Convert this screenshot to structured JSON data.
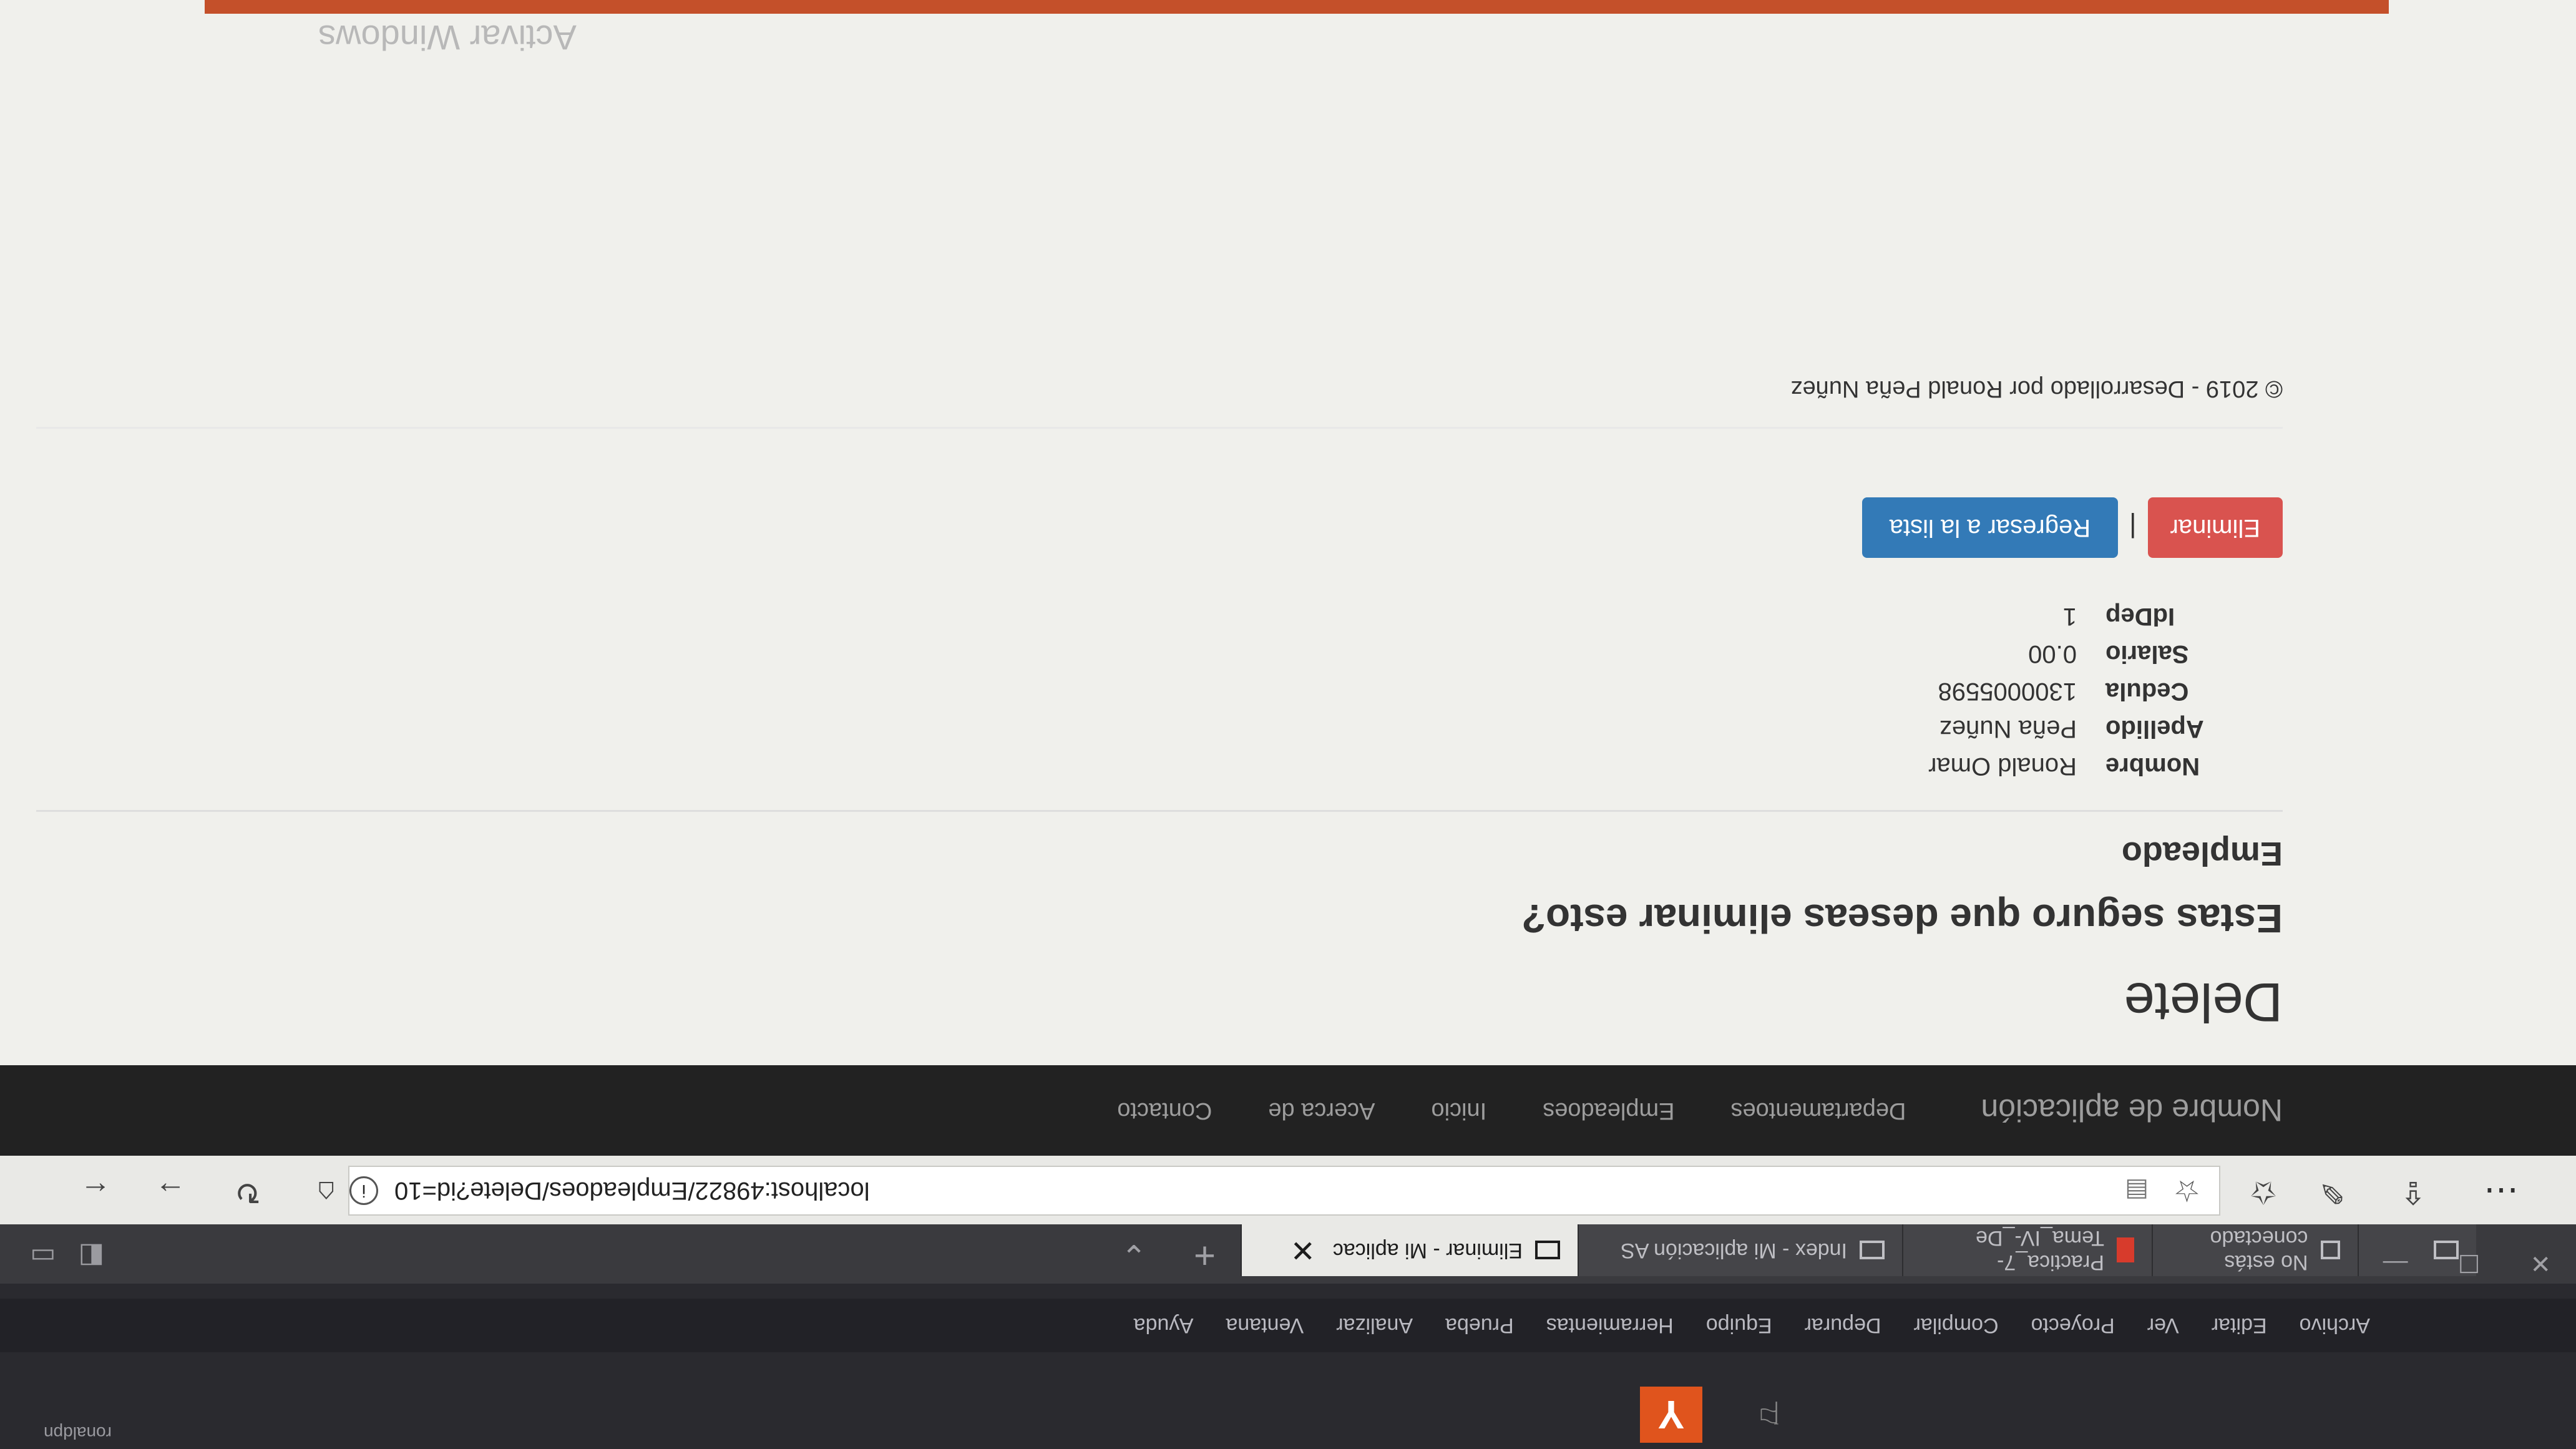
{
  "vs": {
    "user": "ronaldpn",
    "menu": [
      "Archivo",
      "Editar",
      "Ver",
      "Proyecto",
      "Compilar",
      "Depurar",
      "Equipo",
      "Herramientas",
      "Prueba",
      "Analizar",
      "Ventana",
      "Ayuda"
    ]
  },
  "browser": {
    "tabs": [
      {
        "label": "No estás conectado"
      },
      {
        "label": "No estás conectado"
      },
      {
        "label": "Practica_7-Tema_IV-_De"
      },
      {
        "label": "Index - Mi aplicación AS"
      },
      {
        "label": "Eliminar - Mi aplicac"
      }
    ],
    "url": "localhost:49822/Empleadoes/Delete?id=10"
  },
  "app": {
    "brand": "Nombre de aplicación",
    "nav": [
      "Departamentoes",
      "Empleadoes",
      "Inicio",
      "Acerca de",
      "Contacto"
    ]
  },
  "page": {
    "title": "Delete",
    "question": "Estas seguro que deseas eliminar esto?",
    "subheading": "Empleado",
    "fields": [
      {
        "label": "Nombre",
        "value": "Ronald Omar"
      },
      {
        "label": "Apellido",
        "value": "Peña Nuñez"
      },
      {
        "label": "Cedula",
        "value": "1300005598"
      },
      {
        "label": "Salario",
        "value": "0.00"
      },
      {
        "label": "IdDep",
        "value": "1"
      }
    ],
    "delete_label": "Eliminar",
    "separator": "|",
    "back_label": "Regresar a la lista",
    "footer": "© 2019 - Desarrollado por Ronald Peña Nuñez"
  },
  "watermark": "Activar Windows",
  "colors": {
    "danger": "#d9534f",
    "primary": "#337ab7",
    "navbar": "#222222",
    "vs_accent": "#e0541d"
  }
}
